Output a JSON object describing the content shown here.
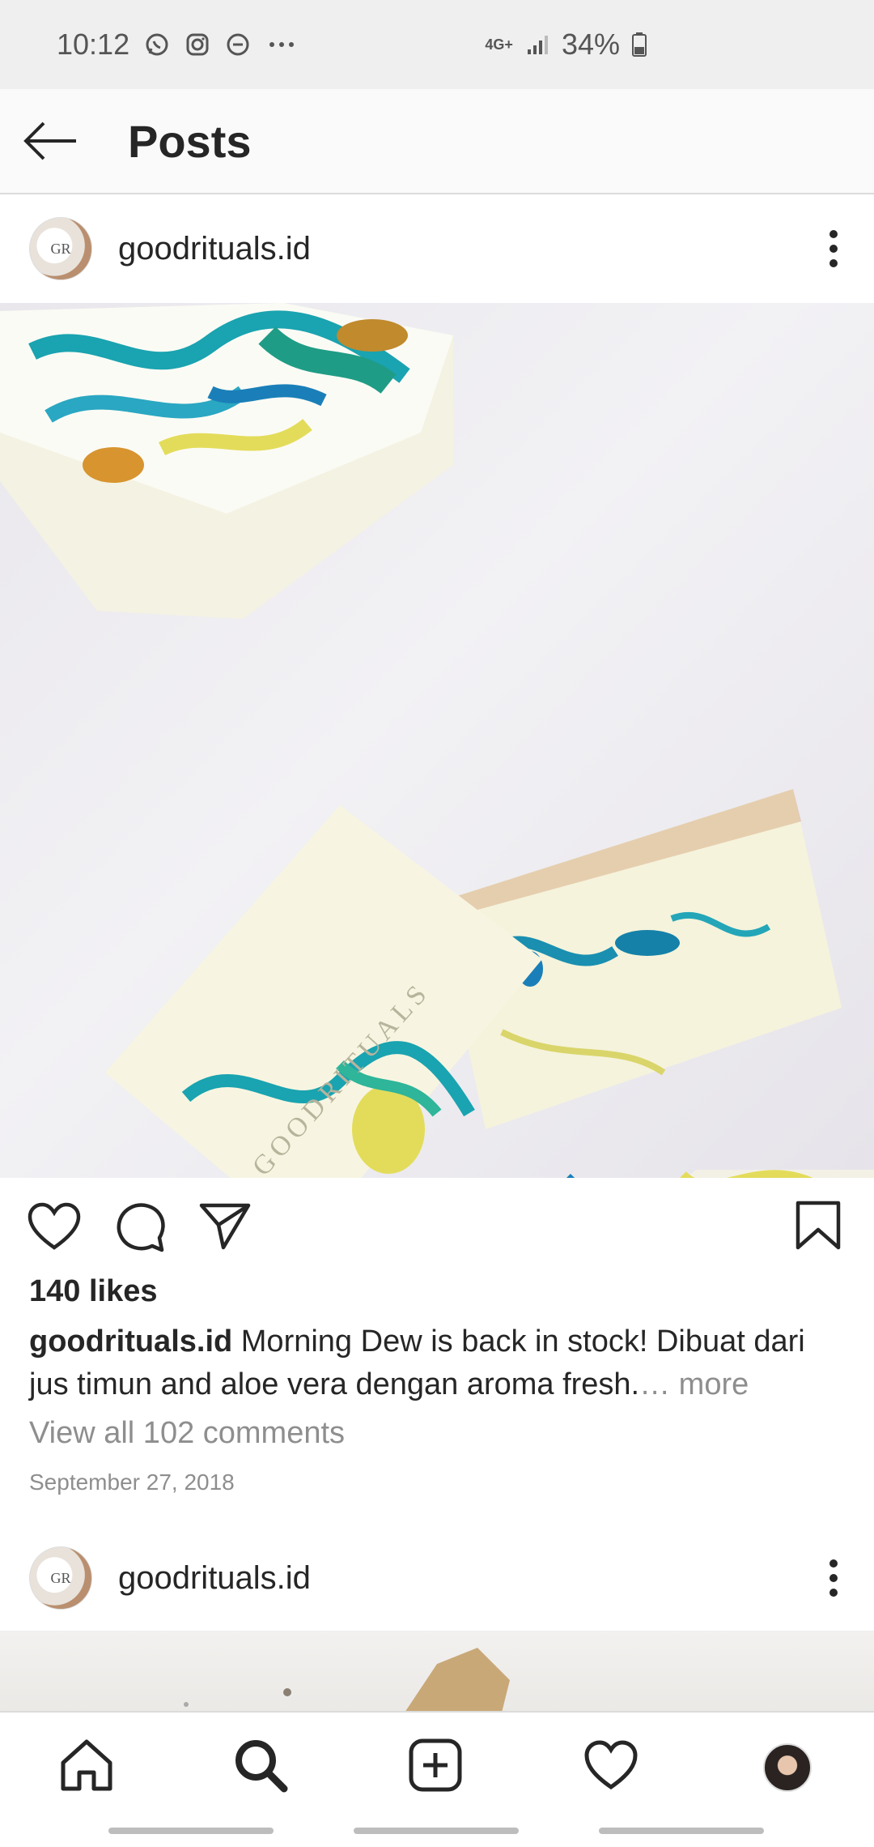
{
  "status_bar": {
    "time": "10:12",
    "network": "4G+",
    "battery": "34%",
    "icons": [
      "whatsapp-icon",
      "instagram-icon",
      "dnd-icon",
      "more-dots-icon",
      "signal-icon",
      "battery-icon"
    ]
  },
  "app_bar": {
    "title": "Posts"
  },
  "post1": {
    "username": "goodrituals.id",
    "avatar_text": "GR",
    "likes": "140 likes",
    "caption_user": "goodrituals.id",
    "caption_text": " Morning Dew is back in stock! Dibuat dari jus timun and aloe vera dengan aroma fresh.",
    "caption_more": "… more",
    "comments_link": "View all 102 comments",
    "date": "September 27, 2018",
    "image_watermark": "GOODRITUALS"
  },
  "post2": {
    "username": "goodrituals.id",
    "avatar_text": "GR"
  },
  "bottom_nav": {
    "items": [
      "home-icon",
      "search-icon",
      "add-post-icon",
      "activity-heart-icon",
      "profile-avatar"
    ]
  },
  "colors": {
    "text": "#262626",
    "muted": "#8e8e8e",
    "divider": "#dbdbdb",
    "teal": "#1aa3b0",
    "yellow": "#e3dc5a"
  }
}
